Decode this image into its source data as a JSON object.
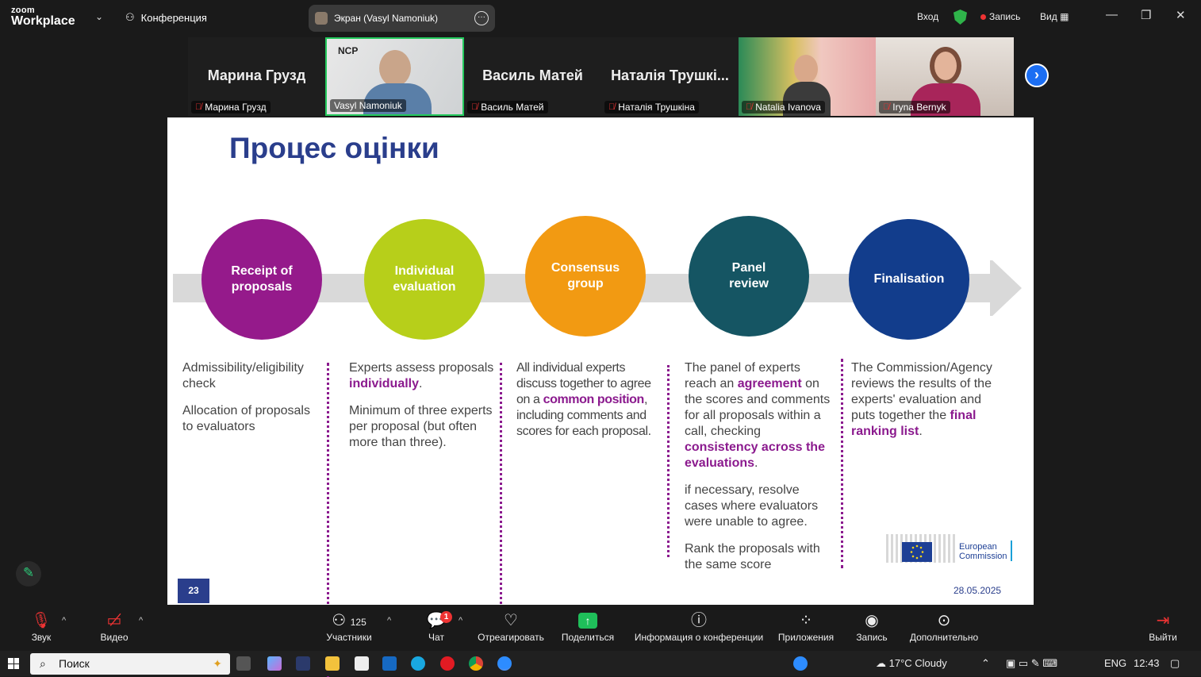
{
  "app": {
    "brand_top": "zoom",
    "brand_bottom": "Workplace",
    "conference_label": "Конференция"
  },
  "screen_share": {
    "label": "Экран (Vasyl Namoniuk)"
  },
  "top_right": {
    "login": "Вход",
    "record": "Запись",
    "view": "Вид"
  },
  "participants": [
    {
      "big_name": "Марина Грузд",
      "label": "Марина Грузд",
      "muted": true,
      "video": false
    },
    {
      "big_name": "",
      "label": "Vasyl Namoniuk",
      "muted": false,
      "video": true,
      "active": true
    },
    {
      "big_name": "Василь Матей",
      "label": "Василь Матей",
      "muted": true,
      "video": false
    },
    {
      "big_name": "Наталія Трушкі...",
      "label": "Наталія Трушкіна",
      "muted": true,
      "video": false
    },
    {
      "big_name": "",
      "label": "Natalia Ivanova",
      "muted": true,
      "video": true
    },
    {
      "big_name": "",
      "label": "Iryna Bernyk",
      "muted": true,
      "video": true
    }
  ],
  "slide": {
    "title": "Процес оцінки",
    "stages": [
      {
        "label": "Receipt of proposals",
        "color": "#951a8b"
      },
      {
        "label": "Individual evaluation",
        "color": "#b7cf1a"
      },
      {
        "label": "Consensus group",
        "color": "#f29a12"
      },
      {
        "label": "Panel review",
        "color": "#155563"
      },
      {
        "label": "Finalisation",
        "color": "#123d8c"
      }
    ],
    "col1": {
      "p1": "Admissibility/eligibility check",
      "p2": "Allocation of proposals to evaluators"
    },
    "col2": {
      "p1a": "Experts assess proposals ",
      "p1b": "individually",
      "p1c": ".",
      "p2": "Minimum of three experts per proposal (but often more than three)."
    },
    "col3": {
      "p1a": "All individual experts discuss together to agree on a ",
      "p1b": "common position",
      "p1c": ", including comments and scores for each proposal."
    },
    "col4": {
      "p1a": "The panel of experts reach an ",
      "p1b": "agreement",
      "p1c": " on the scores and comments for all proposals within a call, checking ",
      "p1d": "consistency across the evaluations",
      "p1e": ".",
      "p2": "if necessary, resolve cases where evaluators were unable to agree.",
      "p3": "Rank the proposals with the same score"
    },
    "col5": {
      "p1a": "The Commission/Agency reviews the results of the experts' evaluation and puts together the ",
      "p1b": "final ranking list",
      "p1c": "."
    },
    "page_number": "23",
    "date": "28.05.2025",
    "ec_line1": "European",
    "ec_line2": "Commission"
  },
  "toolbar": {
    "audio": "Звук",
    "video": "Видео",
    "participants": "Участники",
    "participants_count": "125",
    "chat": "Чат",
    "chat_badge": "1",
    "react": "Отреагировать",
    "share": "Поделиться",
    "info": "Информация о конференции",
    "apps": "Приложения",
    "record": "Запись",
    "more": "Дополнительно",
    "leave": "Выйти"
  },
  "taskbar": {
    "search": "Поиск",
    "weather": "17°C  Cloudy",
    "lang": "ENG",
    "time": "12:43"
  },
  "colors": {
    "accent": "#1b6ef3",
    "highlight": "#8b1a8e",
    "title": "#2a3e8c",
    "active_border": "#24c95d"
  }
}
